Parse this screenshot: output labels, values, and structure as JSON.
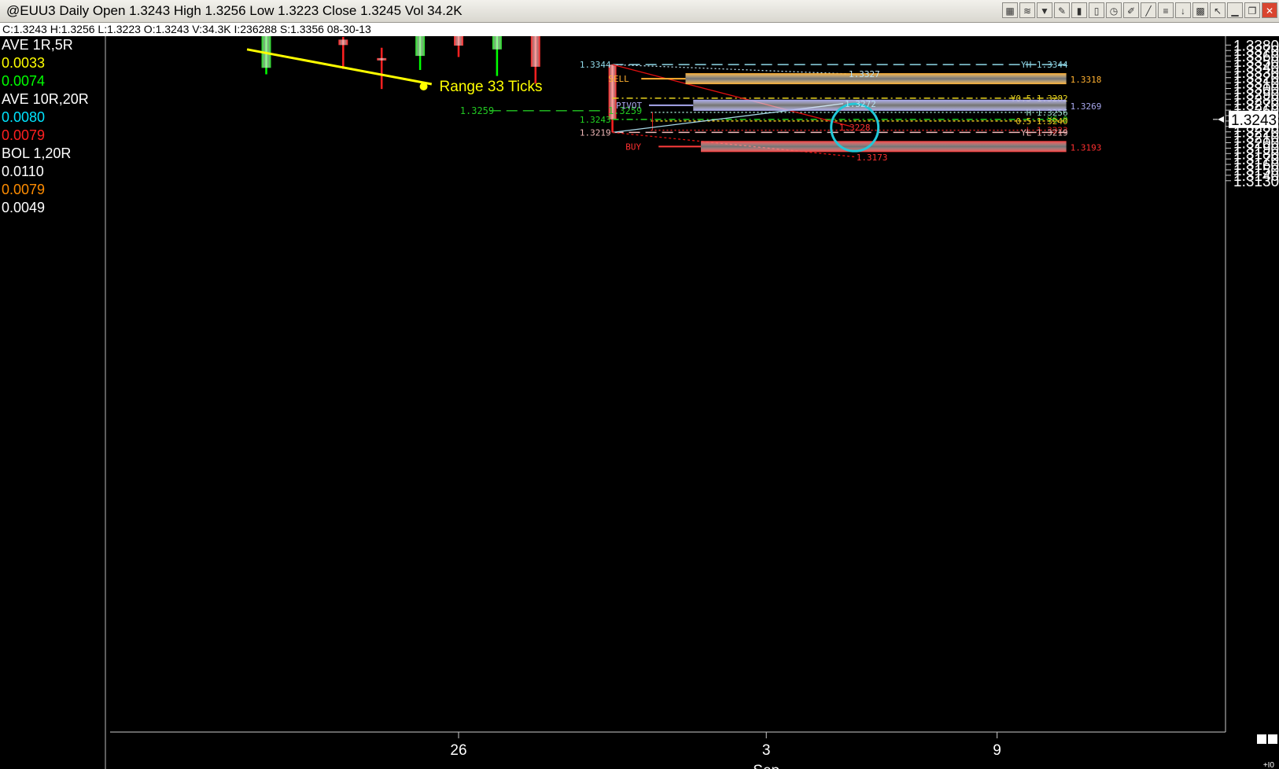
{
  "window": {
    "title": "@EUU3 Daily Open 1.3243 High 1.3256 Low 1.3223 Close 1.3245 Vol 34.2K",
    "toolbar_icons": [
      "chart-icon",
      "wave-icon",
      "filter-icon",
      "pencil-icon",
      "bars-icon",
      "candle-icon",
      "clock-icon",
      "drawing-icon",
      "line-icon",
      "fib-icon",
      "arrow-down-icon",
      "trash-icon",
      "cursor-icon",
      "minimize-icon",
      "restore-icon",
      "close-icon"
    ]
  },
  "infobar": {
    "text": "C:1.3243  H:1.3256  L:1.3223  O:1.3243  V:34.3K  I:236288  S:1.3356  08-30-13"
  },
  "studies": [
    {
      "text": "AVE  1R,5R",
      "color": "#ffffff"
    },
    {
      "text": "0.0033",
      "color": "#ffff00"
    },
    {
      "text": "0.0074",
      "color": "#00ff00"
    },
    {
      "text": "AVE  10R,20R",
      "color": "#ffffff"
    },
    {
      "text": "0.0080",
      "color": "#00e5ff"
    },
    {
      "text": "0.0079",
      "color": "#ff2020"
    },
    {
      "text": "BOL  1,20R",
      "color": "#ffffff"
    },
    {
      "text": "0.0110",
      "color": "#ffffff"
    },
    {
      "text": "0.0079",
      "color": "#ff8c00"
    },
    {
      "text": "0.0049",
      "color": "#ffffff"
    }
  ],
  "chart_data": {
    "type": "candlestick",
    "ylim": [
      1.3125,
      1.3387
    ],
    "yticks": [
      "1.3380",
      "1.3370",
      "1.3360",
      "1.3350",
      "1.3340",
      "1.3330",
      "1.3320",
      "1.3310",
      "1.3300",
      "1.3290",
      "1.3280",
      "1.3270",
      "1.3260",
      "1.3250",
      "1.3240",
      "1.3230",
      "1.3220",
      "1.3210",
      "1.3200",
      "1.3190",
      "1.3180",
      "1.3170",
      "1.3160",
      "1.3150",
      "1.3140",
      "1.3130"
    ],
    "current_price_label": "1.3243",
    "xticks": [
      {
        "label": "26",
        "day": 26
      },
      {
        "label": "3",
        "day": 34
      },
      {
        "label": "9",
        "day": 40
      }
    ],
    "x_sublabel": {
      "text": "Sep",
      "day": 34
    },
    "x_corner_label": "+I0",
    "candles": [
      {
        "day": 21,
        "open": 1.3338,
        "close": 1.342,
        "high": 1.343,
        "low": 1.3326,
        "color": "#00ff00"
      },
      {
        "day": 23,
        "open": 1.339,
        "close": 1.338,
        "high": 1.3395,
        "low": 1.3336,
        "color": "#ff2020"
      },
      {
        "day": 24,
        "open": 1.3356,
        "close": 1.3354,
        "high": 1.3375,
        "low": 1.3299,
        "color": "#ff2020"
      },
      {
        "day": 25,
        "open": 1.336,
        "close": 1.342,
        "high": 1.343,
        "low": 1.3334,
        "color": "#00ff00"
      },
      {
        "day": 26,
        "open": 1.34,
        "close": 1.3379,
        "high": 1.3405,
        "low": 1.3358,
        "color": "#ff2020"
      },
      {
        "day": 27,
        "open": 1.3372,
        "close": 1.342,
        "high": 1.343,
        "low": 1.3323,
        "color": "#00ff00"
      },
      {
        "day": 28,
        "open": 1.341,
        "close": 1.334,
        "high": 1.3415,
        "low": 1.3309,
        "color": "#ff2020"
      },
      {
        "day": 30,
        "open": 1.3344,
        "close": 1.3243,
        "high": 1.3344,
        "low": 1.3219,
        "color": "#ff2020"
      }
    ],
    "trendline": {
      "x1": 20.5,
      "y1": 1.3372,
      "x2": 25.3,
      "y2": 1.3308,
      "color": "#ffff00"
    },
    "range_label": {
      "text": "Range  33 Ticks",
      "day": 25.5,
      "price": 1.3308,
      "color": "#ffff00"
    },
    "levels": [
      {
        "label_right": "YH 1.3344",
        "price": 1.3344,
        "x1": 30,
        "x2": 41.8,
        "color": "#8fd8e8",
        "dash": "14,7"
      },
      {
        "label_right": "Y0.5 1.3282",
        "price": 1.3282,
        "x1": 30,
        "x2": 41.8,
        "color": "#e6d21e",
        "dash": "8,4,2,4"
      },
      {
        "label_right": "H 1.3256",
        "price": 1.3256,
        "x1": 31,
        "x2": 41.8,
        "color": "#9ad8c8",
        "dash": "2,3"
      },
      {
        "label_right": "YC 0",
        "price": 1.3243,
        "x1": 30,
        "x2": 41.8,
        "color": "#22d422",
        "dash": "8,4,2,4"
      },
      {
        "label_right": "0.5 1.3240",
        "price": 1.324,
        "x1": 31,
        "x2": 41.8,
        "color": "#e6c01e",
        "dash": "3,3"
      },
      {
        "label_right": "L 1.3223",
        "price": 1.3223,
        "x1": 31,
        "x2": 41.8,
        "color": "#e02020",
        "dash": "2,3"
      },
      {
        "label_right": "YL 1.3219",
        "price": 1.3219,
        "x1": 30,
        "x2": 41.8,
        "color": "#f0b8b8",
        "dash": "14,7"
      }
    ],
    "zones": [
      {
        "name": "SELL",
        "label": "SELL",
        "value_label": "1.3318",
        "price": 1.3318,
        "x_line": 30.75,
        "x_bar": 31.9,
        "x2": 41.8,
        "color": "#ffb030",
        "text_color": "#ffb030"
      },
      {
        "name": "PIVOT",
        "label": "PIVOT",
        "value_label": "1.3269",
        "price": 1.3269,
        "x_line": 30.95,
        "x_bar": 32.1,
        "x2": 41.8,
        "color": "#a8a8ee",
        "text_color": "#a8a8ee"
      },
      {
        "name": "BUY",
        "label": "BUY",
        "value_label": "1.3193",
        "price": 1.3193,
        "x_line": 31.2,
        "x_bar": 32.3,
        "x2": 41.8,
        "color": "#ff3c3c",
        "text_color": "#ff3030"
      }
    ],
    "point_labels": [
      {
        "text": "1.3344",
        "day": 30,
        "price": 1.3344,
        "color": "#8fd8e8",
        "side": "left"
      },
      {
        "text": "1.3243",
        "day": 30,
        "price": 1.3243,
        "color": "#22d422",
        "side": "left"
      },
      {
        "text": "1.3219",
        "day": 30,
        "price": 1.3219,
        "color": "#f0b8b8",
        "side": "left"
      },
      {
        "text": "1.3327",
        "day": 36.1,
        "price": 1.3327,
        "color": "#b8e0f0",
        "side": "right"
      },
      {
        "text": "1.3272",
        "day": 36,
        "price": 1.3272,
        "color": "#b8e0f0",
        "side": "right"
      },
      {
        "text": "1.3228",
        "day": 36.3,
        "price": 1.3228,
        "color": "#ff3030",
        "side": "center"
      },
      {
        "text": "1.3173",
        "day": 36.3,
        "price": 1.3173,
        "color": "#ff3030",
        "side": "right"
      }
    ],
    "green_line": {
      "left_label": "1.3259",
      "right_label": "1.3259",
      "price": 1.3259,
      "x1": 26.2,
      "x2": 30.6,
      "color": "#22c822"
    },
    "diagonals": [
      {
        "x1": 30,
        "y1": 1.3344,
        "x2": 36.1,
        "y2": 1.3327,
        "color": "#b8e0f0",
        "dash": "2,3"
      },
      {
        "x1": 30,
        "y1": 1.3344,
        "x2": 36.2,
        "y2": 1.323,
        "color": "#e01010",
        "dash": ""
      },
      {
        "x1": 30,
        "y1": 1.3219,
        "x2": 36,
        "y2": 1.3272,
        "color": "#a8d8e8",
        "dash": ""
      },
      {
        "x1": 30,
        "y1": 1.3219,
        "x2": 36.3,
        "y2": 1.3174,
        "color": "#e01010",
        "dash": "3,3"
      }
    ],
    "circle": {
      "day": 36.3,
      "price": 1.3228,
      "color": "#22c8d8"
    },
    "range_box": {
      "x": 31,
      "y_top": 1.3256,
      "y_bottom": 1.3223,
      "color": "#e02020"
    }
  }
}
